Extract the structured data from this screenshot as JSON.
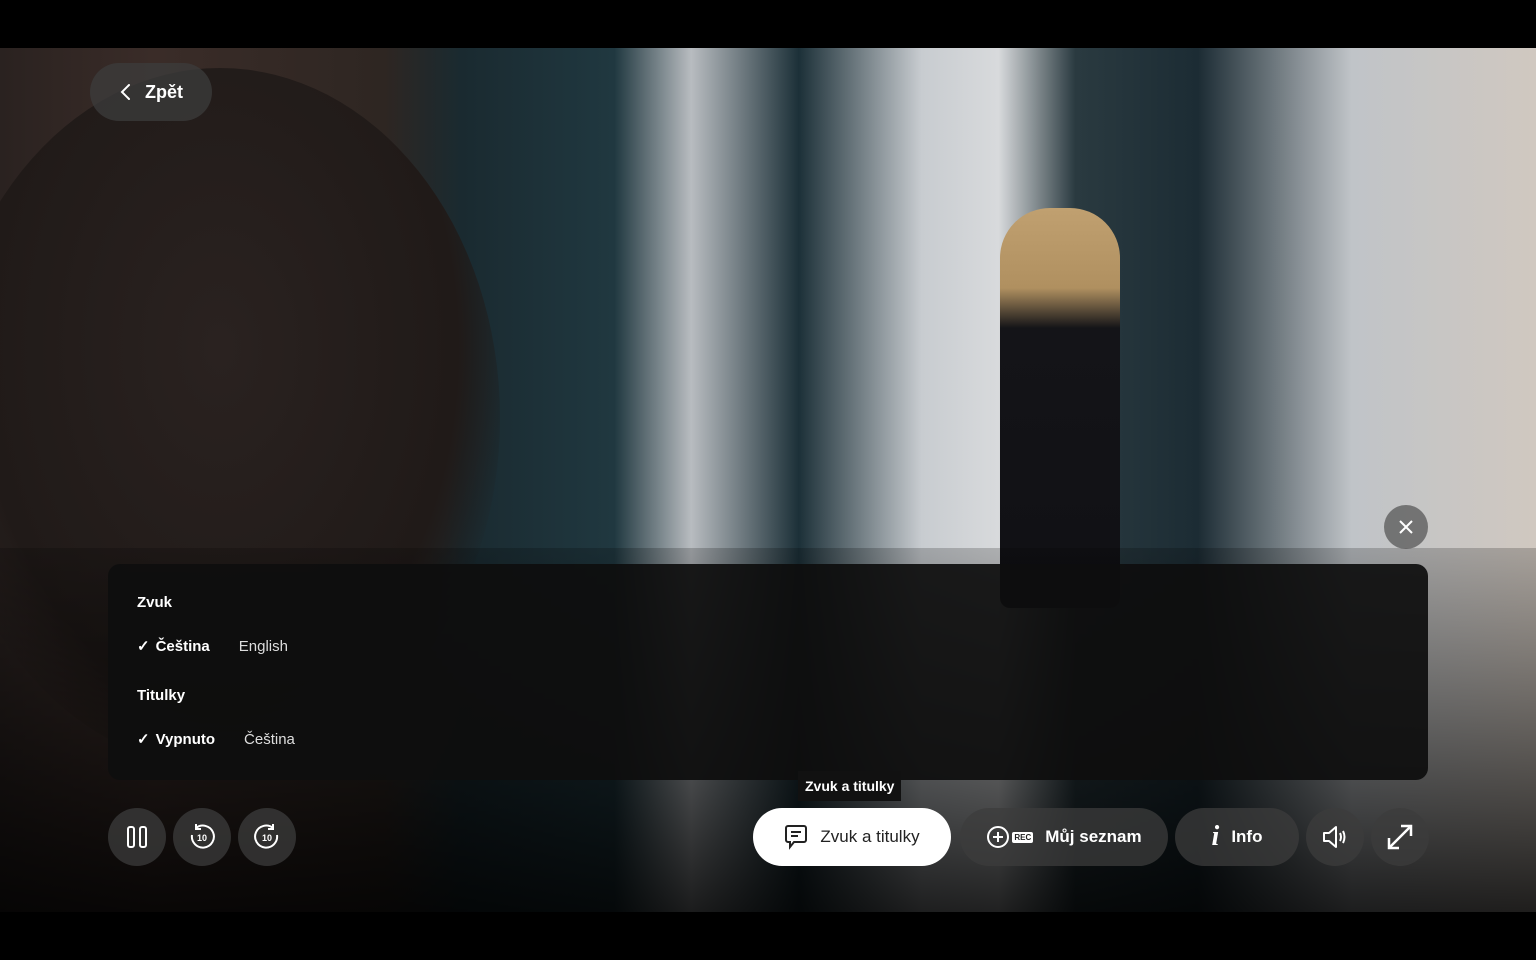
{
  "back": {
    "label": "Zpět"
  },
  "panel": {
    "audio": {
      "title": "Zvuk",
      "options": [
        {
          "label": "Čeština",
          "selected": true
        },
        {
          "label": "English",
          "selected": false
        }
      ]
    },
    "subtitles": {
      "title": "Titulky",
      "options": [
        {
          "label": "Vypnuto",
          "selected": true
        },
        {
          "label": "Čeština",
          "selected": false
        }
      ]
    }
  },
  "tooltip": "Zvuk a titulky",
  "controls": {
    "subs_label": "Zvuk a titulky",
    "mylist_label": "Můj seznam",
    "rec_badge": "REC",
    "info_label": "Info",
    "skip_seconds": "10"
  }
}
